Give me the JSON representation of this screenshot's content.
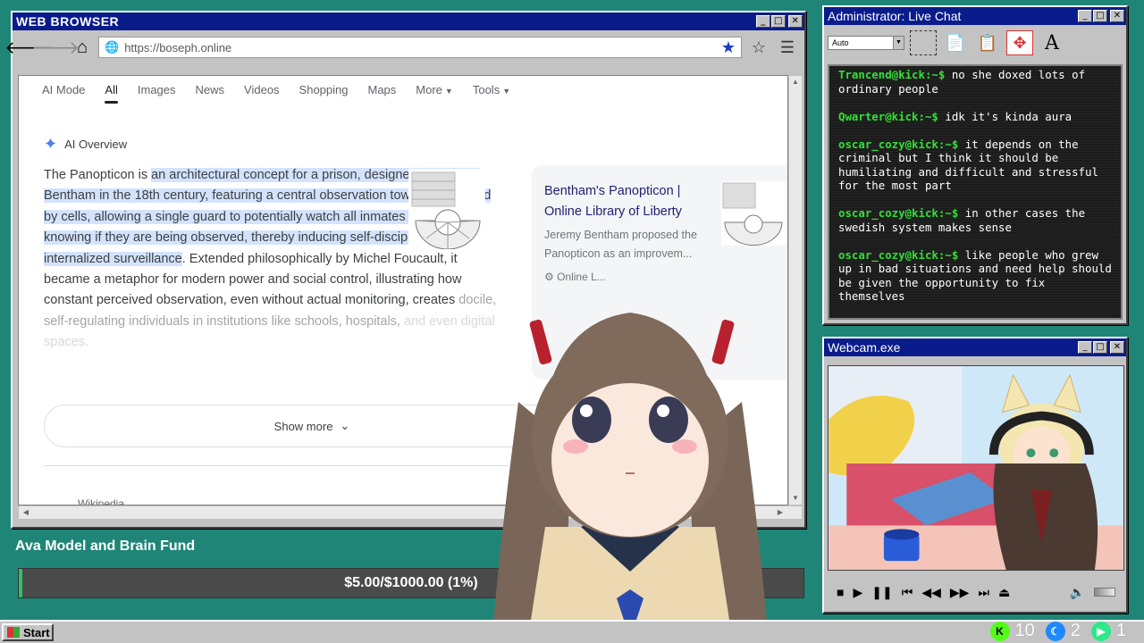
{
  "browser": {
    "title": "WEB BROWSER",
    "url": "https://boseph.online",
    "tabs": [
      "AI Mode",
      "All",
      "Images",
      "News",
      "Videos",
      "Shopping",
      "Maps",
      "More",
      "Tools"
    ],
    "active_tab": "All",
    "ai_overview": {
      "heading": "AI Overview",
      "text_pre": "The Panopticon is ",
      "text_highlight": "an architectural concept for a prison, designed by Jeremy Bentham in the 18th century, featuring a central observation tower surrounded by cells, allowing a single guard to potentially watch all inmates without them knowing if they are being observed, thereby inducing self-discipline through internalized surveillance",
      "text_post": ". Extended philosophically by Michel Foucault, it became a metaphor for modern power and social control, illustrating how constant perceived observation, even without actual monitoring, creates ",
      "text_fade": "docile, self-regulating individuals in institutions like schools, hospitals,",
      "text_fade2": "and even digital spaces."
    },
    "card": {
      "title": "Bentham's Panopticon | Online Library of Liberty",
      "snippet": "Jeremy Bentham proposed the Panopticon as an improvem...",
      "source": "Online L..."
    },
    "show_more": "Show more",
    "wiki_label": "Wikipedia"
  },
  "chat": {
    "title": "Administrator: Live Chat",
    "select_value": "Auto",
    "messages": [
      {
        "user": "Trancend@kick:~$",
        "text": "no she doxed lots of ordinary people"
      },
      {
        "user": "Qwarter@kick:~$",
        "text": "idk it's kinda aura"
      },
      {
        "user": "oscar_cozy@kick:~$",
        "text": "it depends on the criminal but I think it should be humiliating and difficult and stressful for the most part"
      },
      {
        "user": "oscar_cozy@kick:~$",
        "text": "in other cases the swedish system makes sense"
      },
      {
        "user": "oscar_cozy@kick:~$",
        "text": "like people who grew up in bad situations and need help should be given the opportunity to fix themselves"
      }
    ]
  },
  "webcam": {
    "title": "Webcam.exe"
  },
  "fund": {
    "label": "Ava Model and Brain Fund",
    "amount_text": "$5.00/$1000.00 (1%)",
    "progress_fraction": 0.005
  },
  "taskbar": {
    "start_label": "Start",
    "tray": [
      {
        "icon": "kick-icon",
        "count": "10"
      },
      {
        "icon": "moon-icon",
        "count": "2"
      },
      {
        "icon": "play-icon",
        "count": "1"
      }
    ]
  },
  "colors": {
    "desktop": "#1f8577",
    "titlebar": "#0a1c8c",
    "chat_user": "#33e036",
    "highlight": "#d3e3fd"
  }
}
